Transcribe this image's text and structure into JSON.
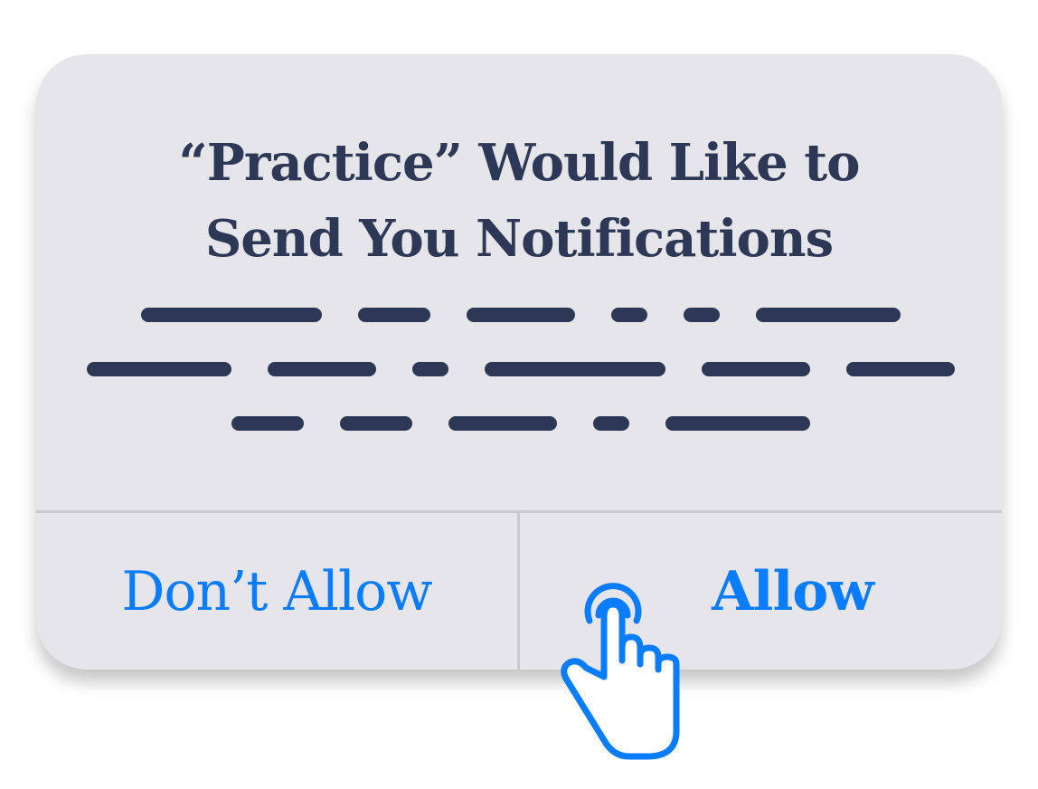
{
  "dialog": {
    "title_line1": "“Practice” Would Like to",
    "title_line2": "Send You Notifications",
    "deny_label": "Don’t Allow",
    "allow_label": "Allow"
  },
  "icons": {
    "pointer": "tap-hand-icon"
  },
  "colors": {
    "dialog_background": "#e5e5ea",
    "title_text": "#2d3756",
    "placeholder_text": "#2d3756",
    "button_text": "#0a7cff",
    "divider": "#c9c9cd"
  }
}
